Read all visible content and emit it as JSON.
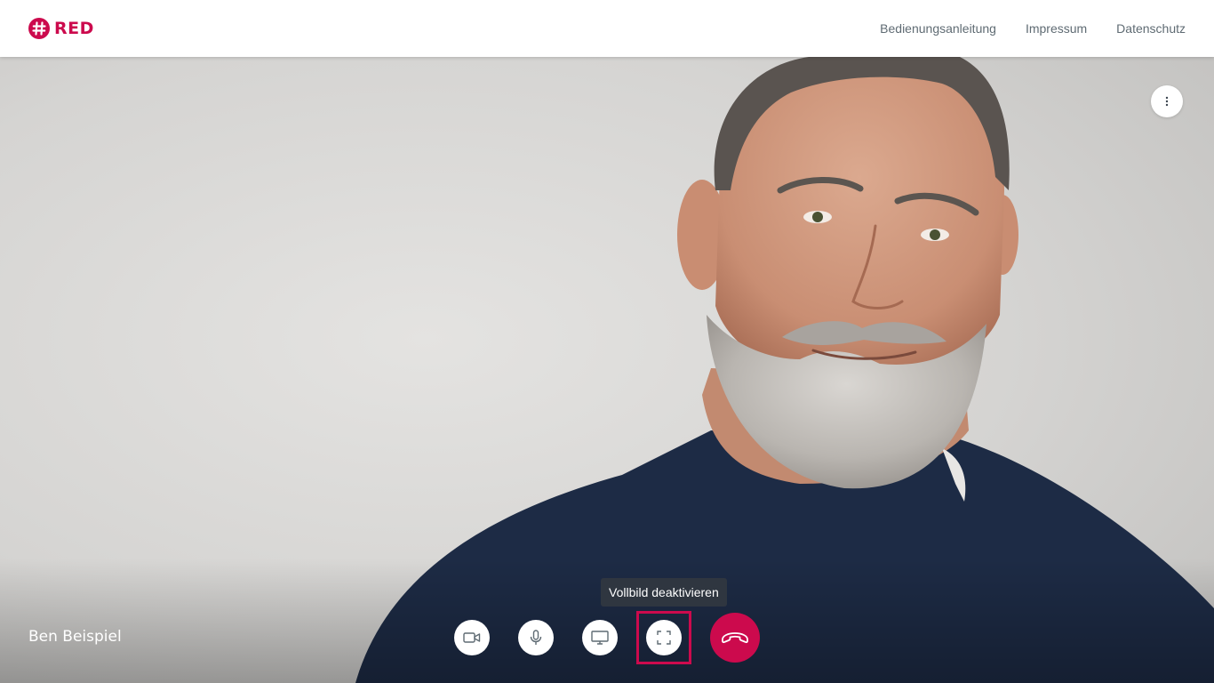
{
  "header": {
    "logo_text": "RED",
    "nav": [
      {
        "label": "Bedienungsanleitung"
      },
      {
        "label": "Impressum"
      },
      {
        "label": "Datenschutz"
      }
    ]
  },
  "call": {
    "participant_name": "Ben Beispiel",
    "tooltip": "Vollbild deaktivieren",
    "controls": [
      {
        "name": "camera-toggle-button",
        "icon": "video-camera-icon"
      },
      {
        "name": "microphone-toggle-button",
        "icon": "microphone-icon"
      },
      {
        "name": "screen-share-button",
        "icon": "monitor-icon"
      },
      {
        "name": "fullscreen-toggle-button",
        "icon": "fullscreen-exit-icon"
      },
      {
        "name": "hang-up-button",
        "icon": "phone-hangup-icon"
      }
    ]
  },
  "colors": {
    "brand": "#cc0a4d",
    "nav_text": "#5f6b73",
    "tooltip_bg": "#2f3640",
    "sweater": "#1d2b45"
  }
}
